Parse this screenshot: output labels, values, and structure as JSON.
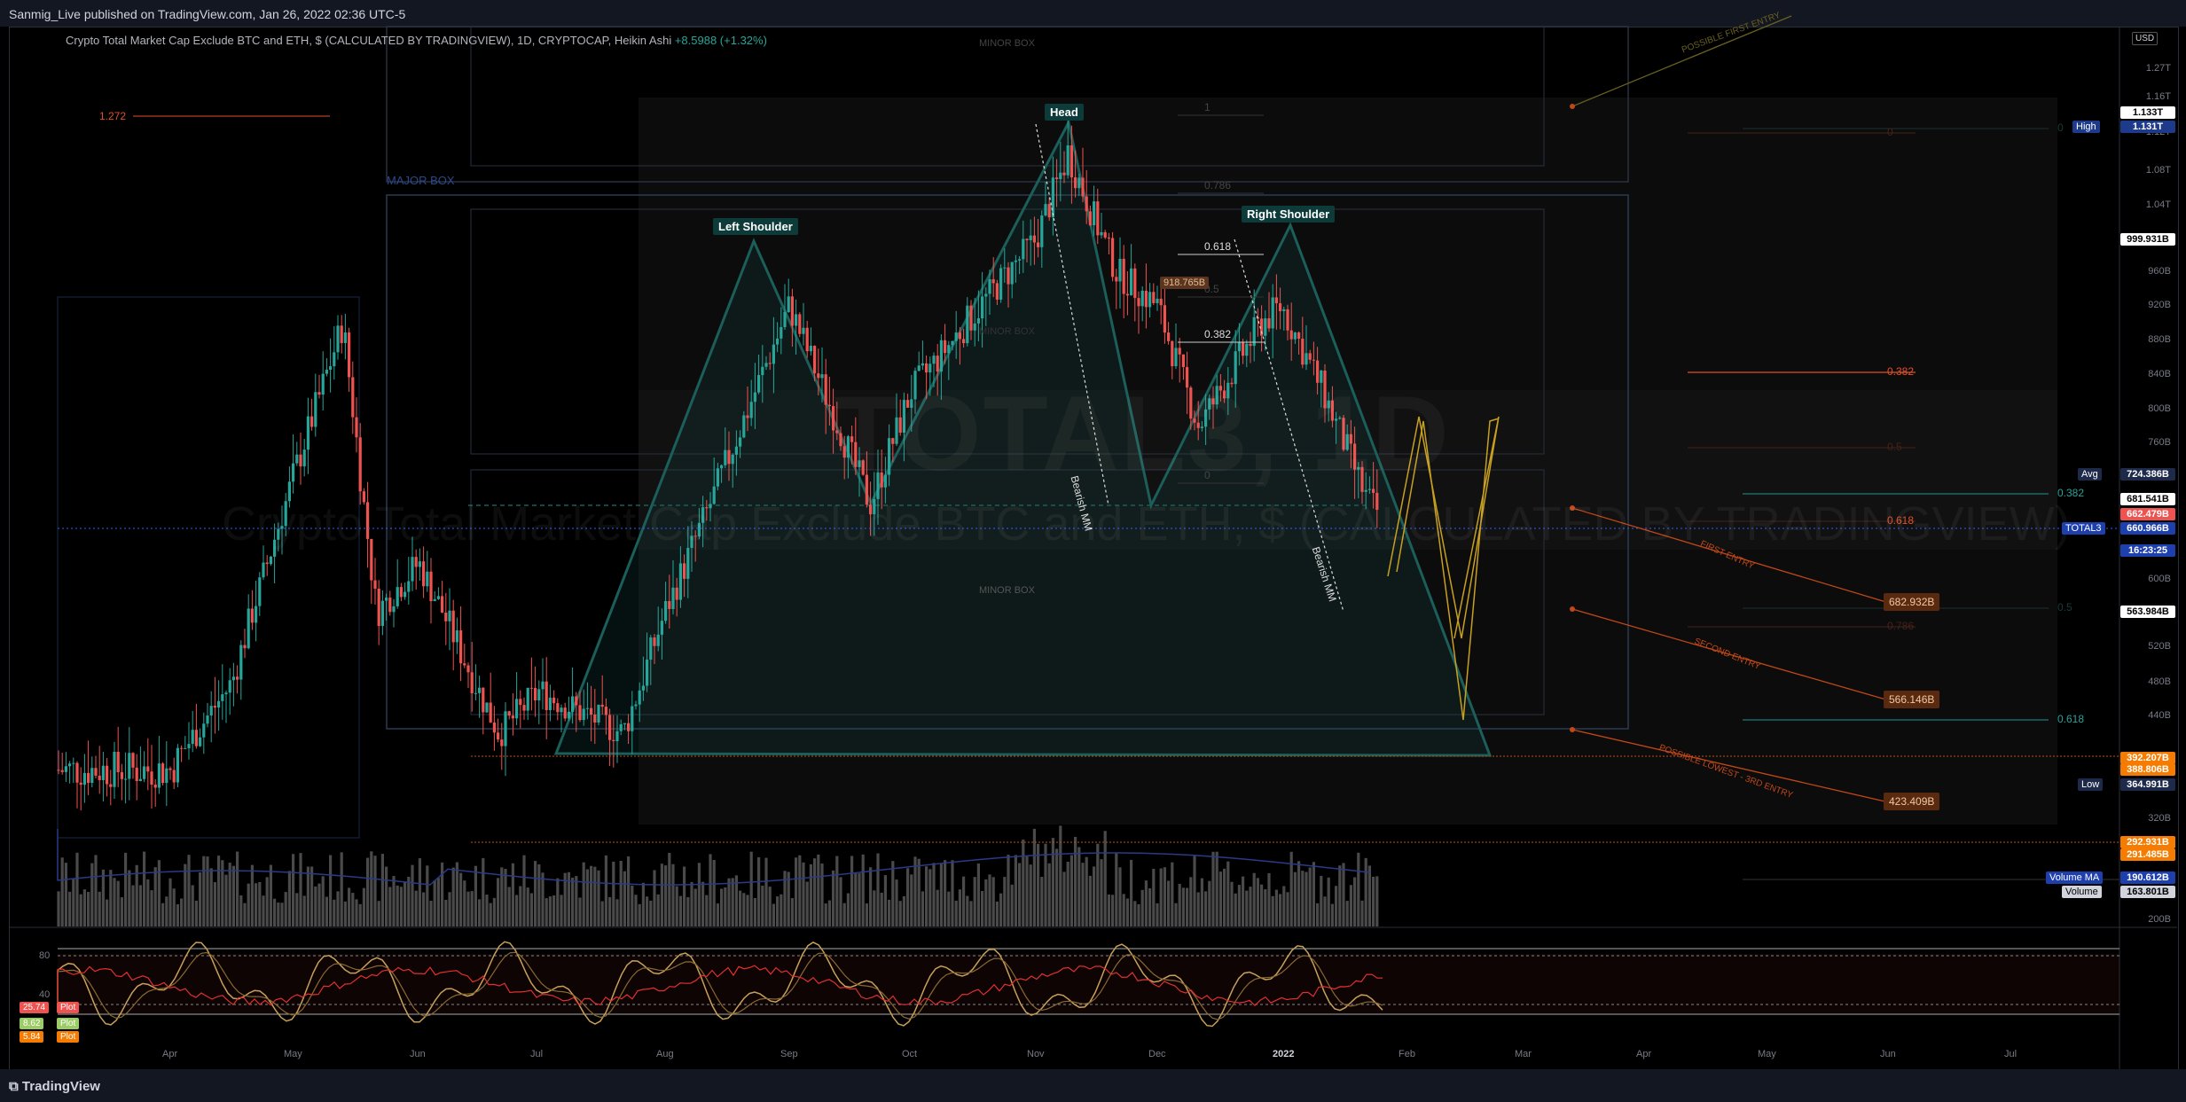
{
  "publisher": "Sanmig_Live published on TradingView.com, Jan 26, 2022 02:36 UTC-5",
  "footer_brand": "TradingView",
  "legend": {
    "title": "Crypto Total Market Cap Exclude BTC and ETH, $ (CALCULATED BY TRADINGVIEW), 1D, CRYPTOCAP, Heikin Ashi",
    "change": "+8.5988 (+1.32%)"
  },
  "watermark": {
    "symbol": "TOTAL3, 1D",
    "description": "Crypto Total Market Cap Exclude BTC and ETH, $ (CALCULATED BY TRADINGVIEW)"
  },
  "currency": "USD",
  "colors": {
    "up": "#26a69a",
    "down": "#ef5350",
    "pattern": "#1b5e5a",
    "fib_red": "#e0502a",
    "fib_teal": "#2aa198",
    "orange": "#f57c00",
    "stoch_k": "#c8a05a",
    "rsi": "#e03030"
  },
  "chart_data": {
    "type": "candlestick",
    "style": "Heikin Ashi",
    "timeframe": "1D",
    "y_unit": "USD (B = billions, T = trillions)",
    "x_months": [
      "Apr",
      "May",
      "Jun",
      "Jul",
      "Aug",
      "Sep",
      "Oct",
      "Nov",
      "Dec",
      "2022",
      "Feb",
      "Mar",
      "Apr",
      "May",
      "Jun",
      "Jul"
    ],
    "y_ticks": [
      "1.27T",
      "1.16T",
      "1.12T",
      "1.08T",
      "1.04T",
      "960B",
      "920B",
      "880B",
      "840B",
      "800B",
      "760B",
      "600B",
      "520B",
      "480B",
      "440B",
      "320B",
      "280B",
      "200B"
    ],
    "price_path_approx": [
      {
        "x": "Apr",
        "y": 380
      },
      {
        "x": "Apr-15",
        "y": 480
      },
      {
        "x": "May",
        "y": 720
      },
      {
        "x": "May-12",
        "y": 900
      },
      {
        "x": "May-20",
        "y": 560
      },
      {
        "x": "Jun",
        "y": 620
      },
      {
        "x": "Jun-20",
        "y": 420
      },
      {
        "x": "Jul",
        "y": 470
      },
      {
        "x": "Jul-20",
        "y": 420
      },
      {
        "x": "Aug",
        "y": 560
      },
      {
        "x": "Aug-20",
        "y": 800
      },
      {
        "x": "Sep",
        "y": 920
      },
      {
        "x": "Sep-20",
        "y": 690
      },
      {
        "x": "Oct",
        "y": 820
      },
      {
        "x": "Oct-20",
        "y": 940
      },
      {
        "x": "Nov",
        "y": 1000
      },
      {
        "x": "Nov-08",
        "y": 1100
      },
      {
        "x": "Nov-20",
        "y": 960
      },
      {
        "x": "Dec",
        "y": 920
      },
      {
        "x": "Dec-10",
        "y": 780
      },
      {
        "x": "Dec-25",
        "y": 900
      },
      {
        "x": "Jan",
        "y": 920
      },
      {
        "x": "Jan-10",
        "y": 820
      },
      {
        "x": "Jan-20",
        "y": 700
      },
      {
        "x": "Jan-26",
        "y": 661
      }
    ],
    "pattern": {
      "name": "Head and Shoulders",
      "labels": [
        "Left Shoulder",
        "Head",
        "Right Shoulder"
      ],
      "projection_labels": [
        "Bearish MM",
        "Bearish MM"
      ]
    },
    "boxes": [
      "MAJOR BOX",
      "MINOR BOX",
      "MINOR BOX",
      "MINOR BOX"
    ],
    "fib_left": {
      "label": "1.272"
    },
    "fib_mid": [
      "1",
      "0.786",
      "0.618",
      "0.5",
      "0.382",
      "0"
    ],
    "fib_right_red": [
      "0",
      "0.382",
      "0.5",
      "0.618",
      "0.786"
    ],
    "fib_right_teal": [
      "0",
      "0.382",
      "0.5",
      "0.618"
    ],
    "annotation_918": "918.765B",
    "entries": [
      {
        "label": "POSSIBLE FIRST ENTRY",
        "value": ""
      },
      {
        "label": "FIRST ENTRY",
        "value": "682.932B"
      },
      {
        "label": "SECOND ENTRY",
        "value": "566.146B"
      },
      {
        "label": "POSSIBLE LOWEST - 3RD ENTRY",
        "value": "423.409B"
      }
    ],
    "price_scale_tags": [
      {
        "label": "",
        "value": "1.133T",
        "bg": "#ffffff",
        "fg": "#000"
      },
      {
        "label": "High",
        "value": "1.131T",
        "bg": "#1e3a8a",
        "fg": "#fff"
      },
      {
        "label": "",
        "value": "999.931B",
        "bg": "#ffffff",
        "fg": "#000"
      },
      {
        "label": "Avg",
        "value": "724.386B",
        "bg": "#1e2a4a",
        "fg": "#fff"
      },
      {
        "label": "",
        "value": "681.541B",
        "bg": "#ffffff",
        "fg": "#000"
      },
      {
        "label": "",
        "value": "662.479B",
        "bg": "#ef5350",
        "fg": "#fff"
      },
      {
        "label": "TOTAL3",
        "value": "660.966B",
        "bg": "#1e40af",
        "fg": "#fff"
      },
      {
        "label": "",
        "value": "16:23:25",
        "bg": "#1e40af",
        "fg": "#fff"
      },
      {
        "label": "",
        "value": "563.984B",
        "bg": "#ffffff",
        "fg": "#000"
      },
      {
        "label": "",
        "value": "392.207B",
        "bg": "#f57c00",
        "fg": "#fff"
      },
      {
        "label": "",
        "value": "388.806B",
        "bg": "#f57c00",
        "fg": "#fff"
      },
      {
        "label": "Low",
        "value": "364.991B",
        "bg": "#1e2a4a",
        "fg": "#fff"
      },
      {
        "label": "",
        "value": "292.931B",
        "bg": "#f57c00",
        "fg": "#fff"
      },
      {
        "label": "",
        "value": "291.485B",
        "bg": "#f57c00",
        "fg": "#fff"
      },
      {
        "label": "Volume MA",
        "value": "190.612B",
        "bg": "#1e40af",
        "fg": "#fff"
      },
      {
        "label": "Volume",
        "value": "163.801B",
        "bg": "#d1d4dc",
        "fg": "#000"
      }
    ],
    "oscillator": {
      "levels": [
        "80",
        "40"
      ],
      "plots": [
        {
          "value": "25.74",
          "name": "Plot",
          "color": "#ef5350"
        },
        {
          "value": "8.62",
          "name": "Plot",
          "color": "#9ccc65"
        },
        {
          "value": "5.84",
          "name": "Plot",
          "color": "#f57c00"
        }
      ]
    }
  }
}
